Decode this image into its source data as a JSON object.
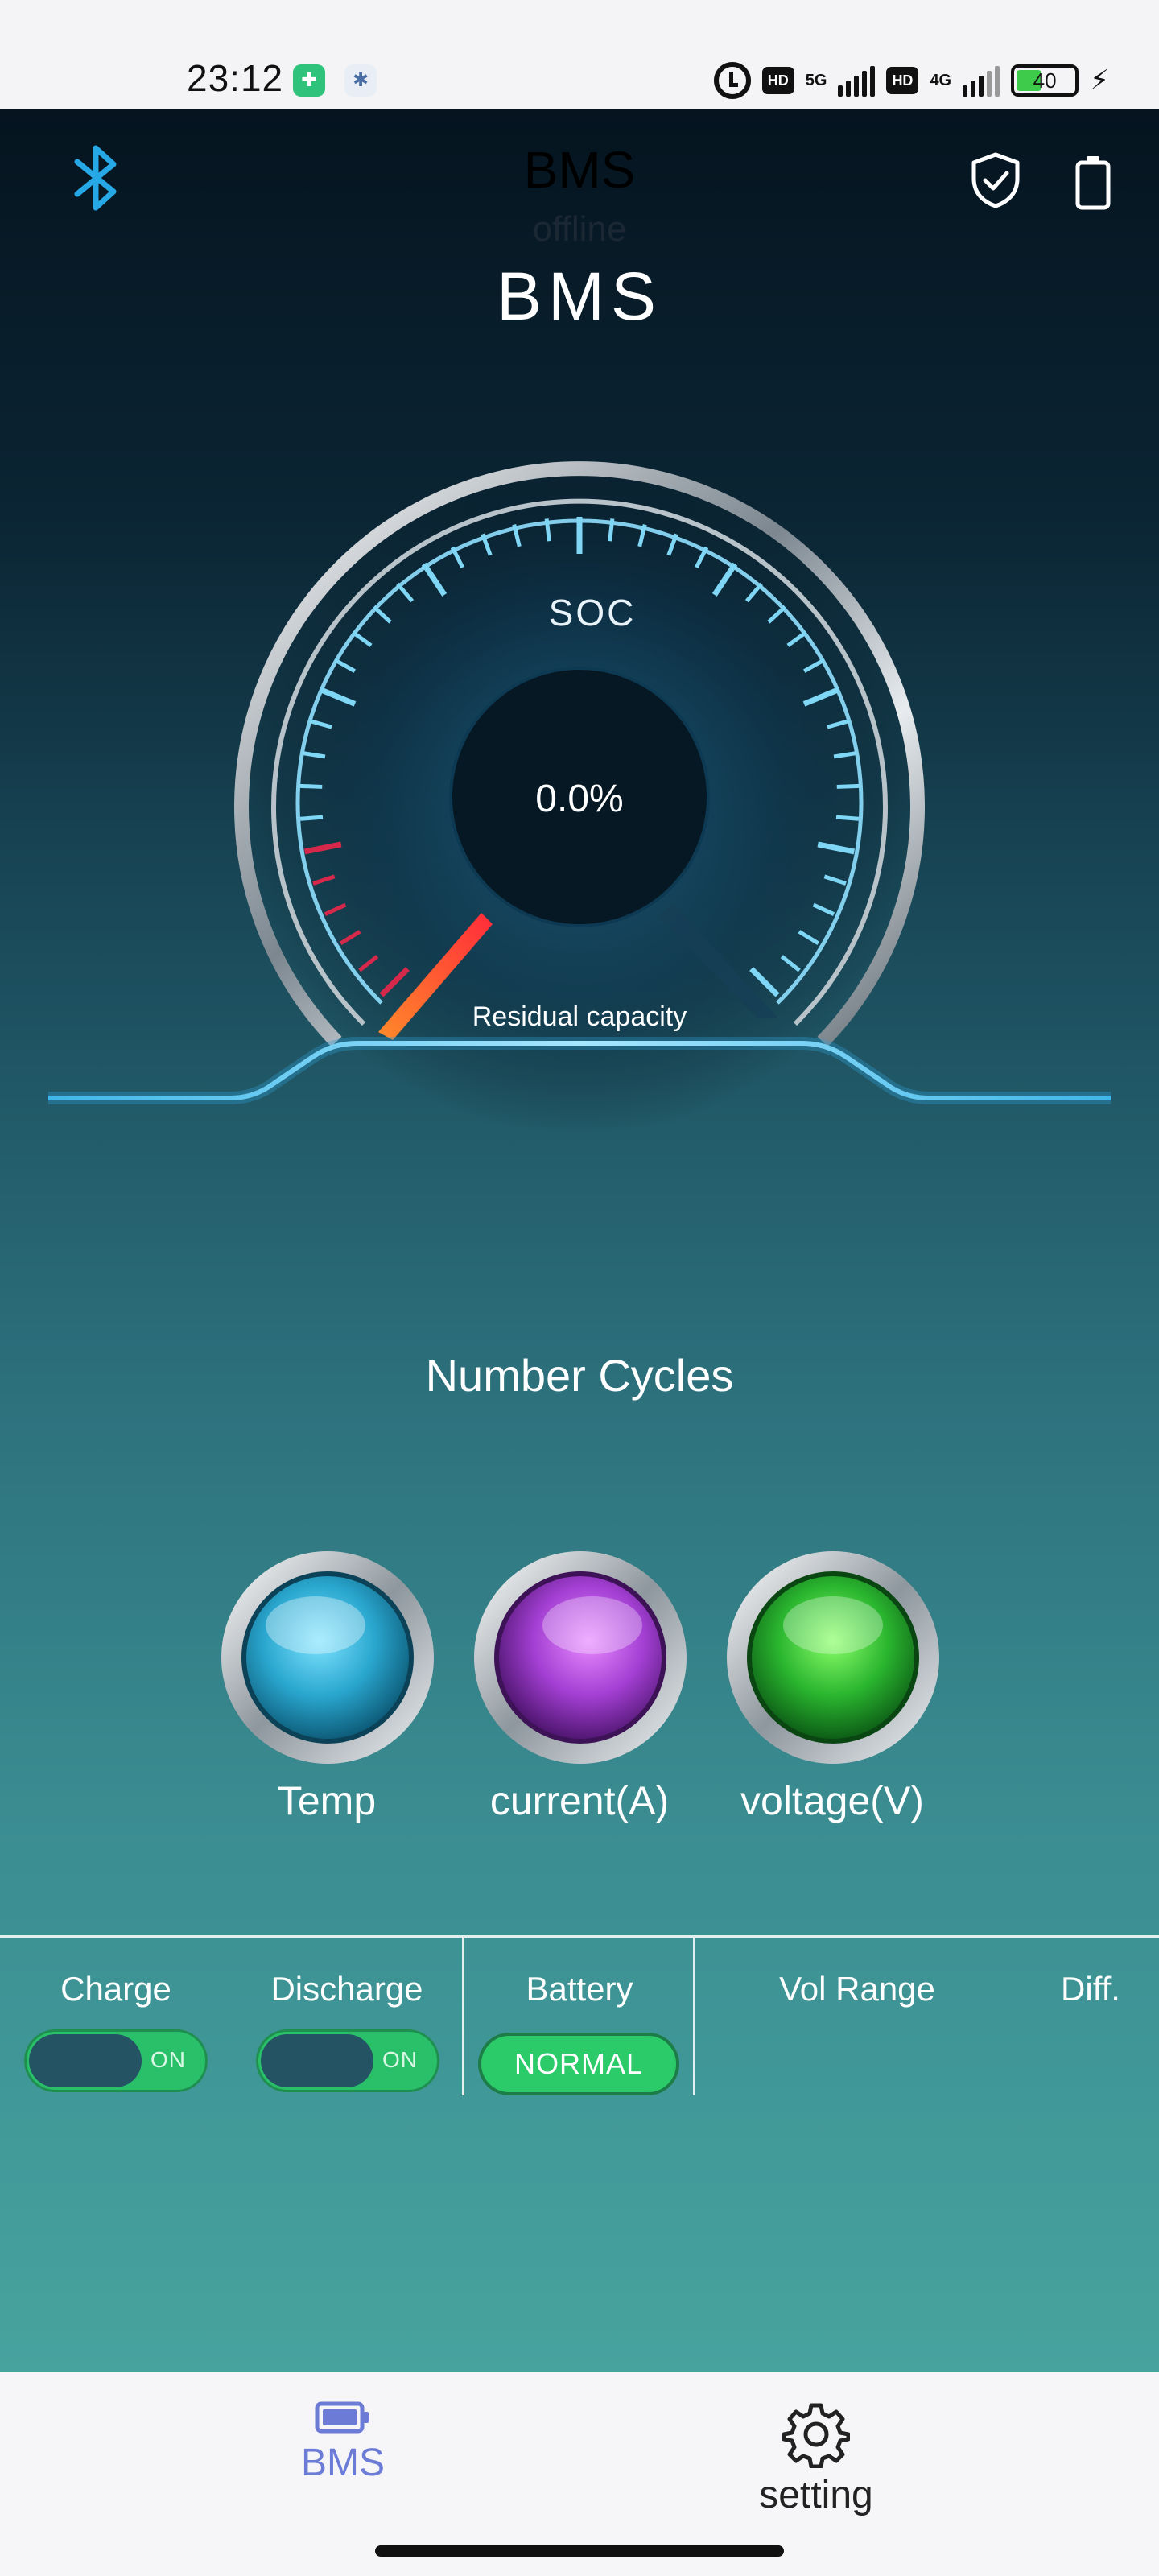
{
  "status_bar": {
    "time": "23:12",
    "network_1": "5G",
    "network_2": "4G",
    "hd_label": "HD",
    "battery_level": "40",
    "icons": [
      "shield-app-icon",
      "settings-app-icon",
      "alarm-icon",
      "signal-icon",
      "battery-icon",
      "charging-icon"
    ]
  },
  "header": {
    "ghost_title": "BMS",
    "ghost_subtitle": "offline",
    "title": "BMS",
    "icons": [
      "bluetooth-icon",
      "shield-check-icon",
      "battery-icon"
    ]
  },
  "gauge": {
    "label": "SOC",
    "value_text": "0.0%",
    "value": 0.0,
    "caption": "Residual capacity"
  },
  "cycles": {
    "label": "Number Cycles"
  },
  "indicators": [
    {
      "label": "Temp",
      "color": "#3cb8d8"
    },
    {
      "label": "current(A)",
      "color": "#b04fdc"
    },
    {
      "label": "voltage(V)",
      "color": "#2fbf35"
    }
  ],
  "panel": {
    "charge": {
      "label": "Charge",
      "state": "ON",
      "on": true
    },
    "discharge": {
      "label": "Discharge",
      "state": "ON",
      "on": true
    },
    "battery": {
      "label": "Battery",
      "status": "NORMAL"
    },
    "vol_range": {
      "label": "Vol Range"
    },
    "diff": {
      "label": "Diff."
    }
  },
  "tabbar": {
    "tabs": [
      {
        "label": "BMS",
        "icon": "battery-tab-icon",
        "active": true,
        "color": "#6b7bd6"
      },
      {
        "label": "setting",
        "icon": "gear-icon",
        "active": false,
        "color": "#222222"
      }
    ]
  },
  "colors": {
    "accent": "#6b7bd6",
    "gauge_tick": "#7fd6f5",
    "needle": "#ff3b3b",
    "switch_on": "#2ac06a"
  }
}
